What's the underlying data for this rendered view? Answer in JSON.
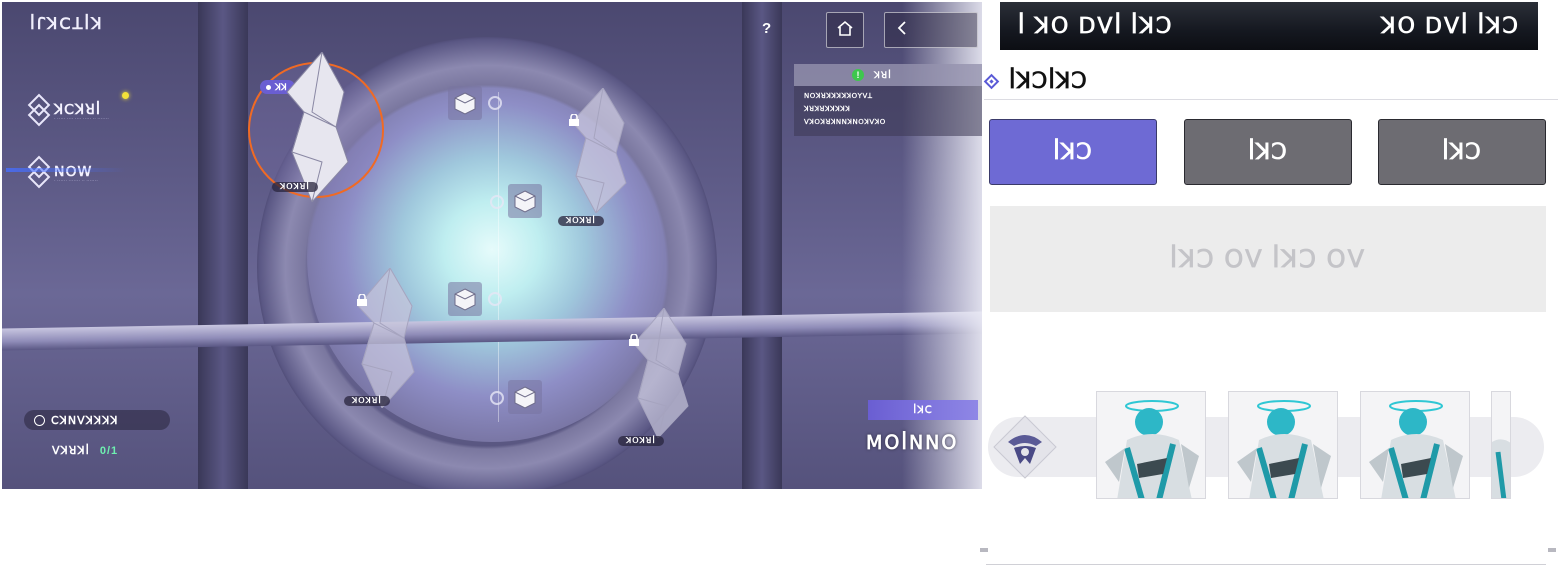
{
  "game": {
    "title": "ꟾꓩꓘꓚꓕꟾꓘ",
    "tracks": [
      {
        "name": "ꓘꓚꓘꓤꟾ",
        "sub": "· ·····  ····  ···· ·····  ··  ·······",
        "active": false
      },
      {
        "name": "ꓠꓳꓪ",
        "sub": "· ······ ······· ·· ·······",
        "active": true
      }
    ],
    "selected_tag": "ꓘꓘ",
    "node_label": "ꓘꓳꓘꓤꟾ",
    "help_label": "?",
    "quest": {
      "title": "ꓘꓤꟾ",
      "lines": [
        "ꓠꓳꓘꓤꓘꓘꓘꓘꓘꓳꓬꓦꓕ",
        "ꓘꓤꓘꓤꓘꓘꓘꓘꓘ",
        "ꓦꓘꓳꓘꓤꓘꓠꓠꓘꓠꓳꓘꓦꓘꓳ"
      ]
    },
    "timer_label": "ꓚꓘꓠꓦꓘꓘꓘꓘ",
    "progress_label": "ꓦꓘꓤꓘꟾ",
    "progress_value": "0/1",
    "reward_label": "ꟾꓘꓚ",
    "mission_text": "ꓟꓳꟾꓠꓠꓳ"
  },
  "panel": {
    "banner_left": "ꟾ ꓘꓳ ꓓꓦꟾ ꟾꓘꓛ",
    "banner_right": "ꓘꓳ ꓓꓦꟾ ꟾꓘꓛ",
    "section_title": "ꟾꓘꓛꟾꓘꓛ",
    "tabs": [
      {
        "label": "ꟾꓘꓛ",
        "active": true
      },
      {
        "label": "ꟾꓘꓛ",
        "active": false
      },
      {
        "label": "ꟾꓘꓛ",
        "active": false
      }
    ],
    "empty_text": "ꟾꓘꓛ ꓳꓦ ꟾꓘꓛ ꓳꓦ",
    "characters": [
      "character-card",
      "character-card",
      "character-card",
      "character-card"
    ]
  },
  "colors": {
    "accent": "#6e6ad4",
    "tab_inactive": "#6d6c72",
    "selection_ring": "#f06a24",
    "progress_value": "#6ef0b0",
    "quest_check": "#3ec74d"
  }
}
